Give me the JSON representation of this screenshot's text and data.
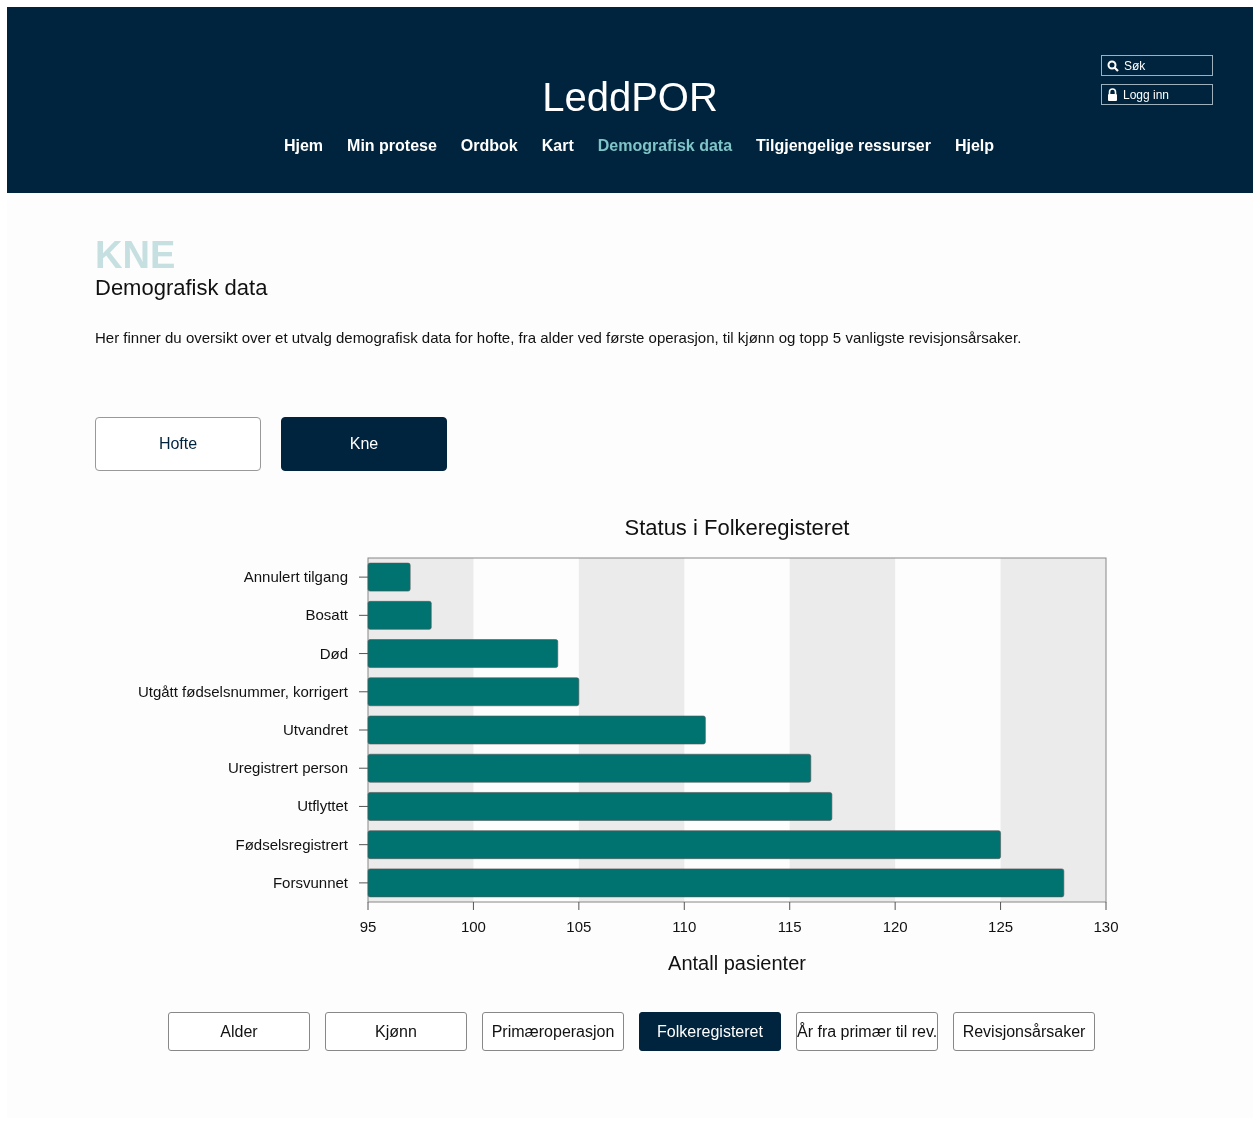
{
  "header": {
    "title": "LeddPOR",
    "search": "Søk",
    "login": "Logg inn"
  },
  "nav": [
    {
      "label": "Hjem",
      "selected": false
    },
    {
      "label": "Min protese",
      "selected": false
    },
    {
      "label": "Ordbok",
      "selected": false
    },
    {
      "label": "Kart",
      "selected": false
    },
    {
      "label": "Demografisk data",
      "selected": true
    },
    {
      "label": "Tilgjengelige ressurser",
      "selected": false
    },
    {
      "label": "Hjelp",
      "selected": false
    }
  ],
  "page": {
    "kicker": "KNE",
    "title": "Demografisk data",
    "intro": "Her finner du oversikt over et utvalg demografisk data for hofte, fra alder ved første operasjon, til kjønn og topp 5 vanligste revisjonsårsaker."
  },
  "joint_tabs": [
    {
      "label": "Hofte",
      "selected": false
    },
    {
      "label": "Kne",
      "selected": true
    }
  ],
  "chart": {
    "chart_data": {
      "type": "bar",
      "orientation": "horizontal",
      "title": "Status i Folkeregisteret",
      "xlabel": "Antall pasienter",
      "categories": [
        "Annulert tilgang",
        "Bosatt",
        "Død",
        "Utgått fødselsnummer, korrigert",
        "Utvandret",
        "Uregistrert person",
        "Utflyttet",
        "Fødselsregistrert",
        "Forsvunnet"
      ],
      "values": [
        97,
        98,
        104,
        105,
        111,
        116,
        117,
        125,
        128
      ],
      "xlim": [
        95,
        130
      ],
      "xticks": [
        95,
        100,
        105,
        110,
        115,
        120,
        125,
        130
      ]
    }
  },
  "chart_tabs": [
    {
      "label": "Alder",
      "selected": false
    },
    {
      "label": "Kjønn",
      "selected": false
    },
    {
      "label": "Primæroperasjon",
      "selected": false
    },
    {
      "label": "Folkeregisteret",
      "selected": true
    },
    {
      "label": "År fra primær til rev.",
      "selected": false
    },
    {
      "label": "Revisjonsårsaker",
      "selected": false
    }
  ]
}
